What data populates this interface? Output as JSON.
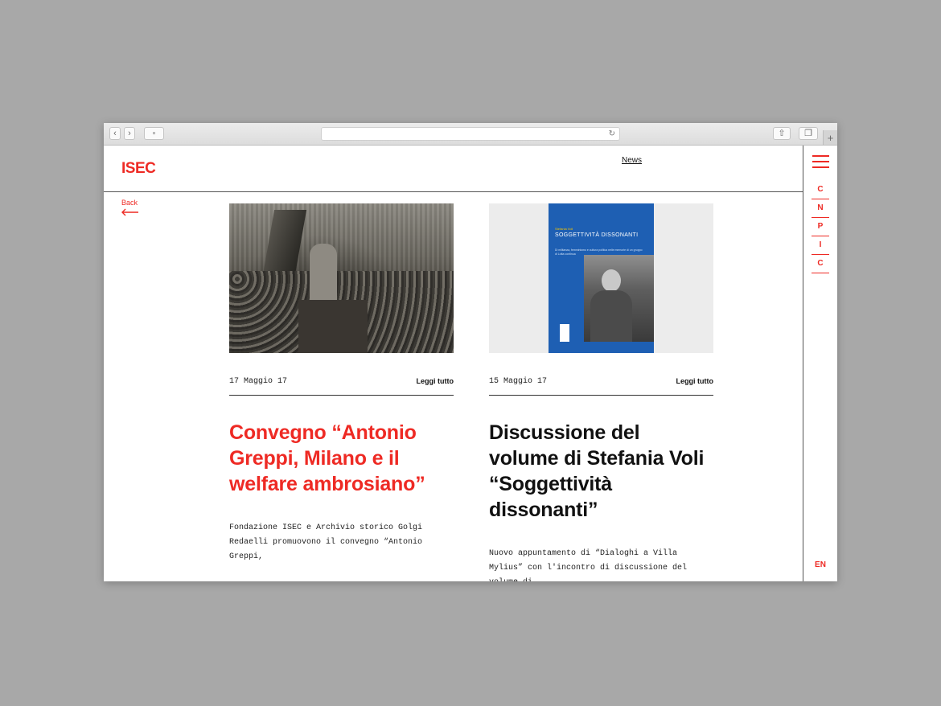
{
  "site": {
    "logo": "ISEC",
    "accent": "#ee2a24"
  },
  "nav": {
    "news": "News"
  },
  "back": {
    "label": "Back"
  },
  "articles": [
    {
      "date": "17 Maggio 17",
      "more": "Leggi tutto",
      "title": "Convegno “Antonio Greppi, Milano e il welfare ambrosiano”",
      "excerpt": "Fondazione ISEC e Archivio storico Golgi Redaelli promuovono il convegno “Antonio Greppi,"
    },
    {
      "date": "15 Maggio 17",
      "more": "Leggi tutto",
      "title": "Discussione del volume di Stefania Voli “Soggettività dissonanti”",
      "excerpt": "Nuovo appuntamento di “Dialoghi a Villa Mylius” con l'incontro di discussione del volume di",
      "book": {
        "author": "Stefania Voli",
        "title": "SOGGETTIVITÀ DISSONANTI",
        "subtitle": "Di militanza, femminismo e cultura politica nelle memorie di un gruppo di Lotta continua"
      }
    }
  ],
  "sidebar": {
    "letters": [
      "C",
      "N",
      "P",
      "I",
      "C"
    ],
    "lang": "EN"
  }
}
